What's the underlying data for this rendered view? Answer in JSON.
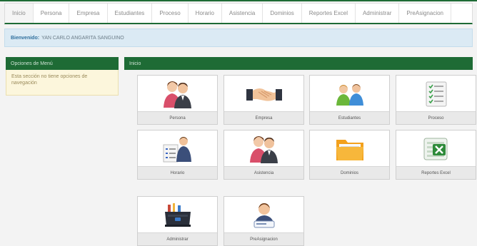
{
  "nav": {
    "items": [
      {
        "label": "Inicio"
      },
      {
        "label": "Persona"
      },
      {
        "label": "Empresa"
      },
      {
        "label": "Estudiantes"
      },
      {
        "label": "Proceso"
      },
      {
        "label": "Horario"
      },
      {
        "label": "Asistencia"
      },
      {
        "label": "Dominios"
      },
      {
        "label": "Reportes Excel"
      },
      {
        "label": "Administrar"
      },
      {
        "label": "PreAsignacion"
      }
    ]
  },
  "welcome": {
    "label": "Bienvenido:",
    "user": "YAN CARLO ANGARITA SANGUINO"
  },
  "left_panel": {
    "title": "Opciones de Menú",
    "message": "Esta sección no tiene opciones de navegación"
  },
  "main_panel": {
    "title": "Inicio"
  },
  "tiles": [
    {
      "label": "Persona",
      "icon": "people-icon"
    },
    {
      "label": "Empresa",
      "icon": "handshake-icon"
    },
    {
      "label": "Estudiantes",
      "icon": "students-icon"
    },
    {
      "label": "Proceso",
      "icon": "checklist-icon"
    },
    {
      "label": "Horario",
      "icon": "schedule-person-icon"
    },
    {
      "label": "Asistencia",
      "icon": "attendance-people-icon"
    },
    {
      "label": "Dominios",
      "icon": "folder-icon"
    },
    {
      "label": "Reportes Excel",
      "icon": "excel-icon"
    },
    {
      "label": "Administrar",
      "icon": "toolbox-icon"
    },
    {
      "label": "PreAsignacion",
      "icon": "user-card-icon"
    }
  ],
  "colors": {
    "green": "#1e6b35",
    "welcome_bg": "#dbeaf4",
    "notice_bg": "#fcf6dc"
  }
}
